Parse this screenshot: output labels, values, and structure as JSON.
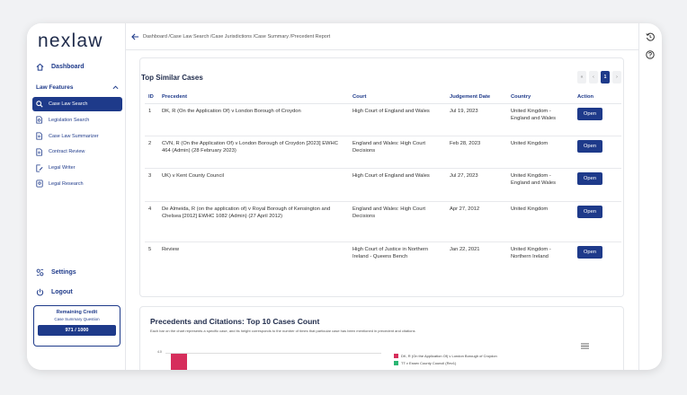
{
  "brand": {
    "logo": "nexlaw"
  },
  "sidebar": {
    "dashboard": "Dashboard",
    "features_heading": "Law Features",
    "features": [
      {
        "label": "Case Law Search",
        "icon": "search-icon",
        "active": true
      },
      {
        "label": "Legislation Search",
        "icon": "document-search-icon",
        "active": false
      },
      {
        "label": "Case Law Summarizer",
        "icon": "document-icon",
        "active": false
      },
      {
        "label": "Contract Review",
        "icon": "document-icon",
        "active": false
      },
      {
        "label": "Legal Writer",
        "icon": "pen-document-icon",
        "active": false
      },
      {
        "label": "Legal Research",
        "icon": "research-icon",
        "active": false
      }
    ],
    "settings": "Settings",
    "logout": "Logout",
    "credit": {
      "title": "Remaining Credit",
      "subtitle": "Case Summary Question",
      "value": "971 / 1000"
    }
  },
  "breadcrumb": "Dashboard /Case Law Search /Case Jurisdictions /Case Summary /Precedent Report",
  "similar_cases": {
    "title": "Top Similar Cases",
    "pager": {
      "first": "«",
      "prev": "‹",
      "current": "1",
      "next": "›"
    },
    "columns": [
      "ID",
      "Precedent",
      "Court",
      "Judgement Date",
      "Country",
      "Action"
    ],
    "rows": [
      {
        "id": "1",
        "precedent": "DK, R (On the Application Of) v London Borough of Croydon",
        "court": "High Court of England and Wales",
        "date": "Jul 19, 2023",
        "country": "United Kingdom - England and Wales",
        "action": "Open"
      },
      {
        "id": "2",
        "precedent": "CVN, R (On the Application Of) v London Borough of Croydon [2023] EWHC 464 (Admin) (28 February 2023)",
        "court": "England and Wales: High Court Decisions",
        "date": "Feb 28, 2023",
        "country": "United Kingdom",
        "action": "Open"
      },
      {
        "id": "3",
        "precedent": "UK) v Kent County Council",
        "court": "High Court of England and Wales",
        "date": "Jul 27, 2023",
        "country": "United Kingdom - England and Wales",
        "action": "Open"
      },
      {
        "id": "4",
        "precedent": "De Almeida, R (on the application of) v Royal Borough of Kensington and Chelsea [2012] EWHC 1082 (Admin) (27 April 2012)",
        "court": "England and Wales: High Court Decisions",
        "date": "Apr 27, 2012",
        "country": "United Kingdom",
        "action": "Open"
      },
      {
        "id": "5",
        "precedent": "Review",
        "court": "High Court of Justice in Northern Ireland - Queens Bench",
        "date": "Jan 22, 2021",
        "country": "United Kingdom - Northern Ireland",
        "action": "Open"
      }
    ]
  },
  "precedents_chart": {
    "title": "Precedents and Citations: Top 10 Cases Count",
    "subtitle": "Each bar on the chart represents a specific case, and its height corresponds to the number of times that particular case has been mentioned in precedent and citations",
    "ytick_top": "4.0",
    "legend": [
      {
        "label": "DK, R (On the Application Of) v London Borough of Croydon",
        "color": "#d62e5c"
      },
      {
        "label": "TT v Essex County Council (Rev1)",
        "color": "#2bb673"
      }
    ]
  },
  "colors": {
    "primary": "#1e3a8a",
    "bar": "#d62e5c"
  }
}
